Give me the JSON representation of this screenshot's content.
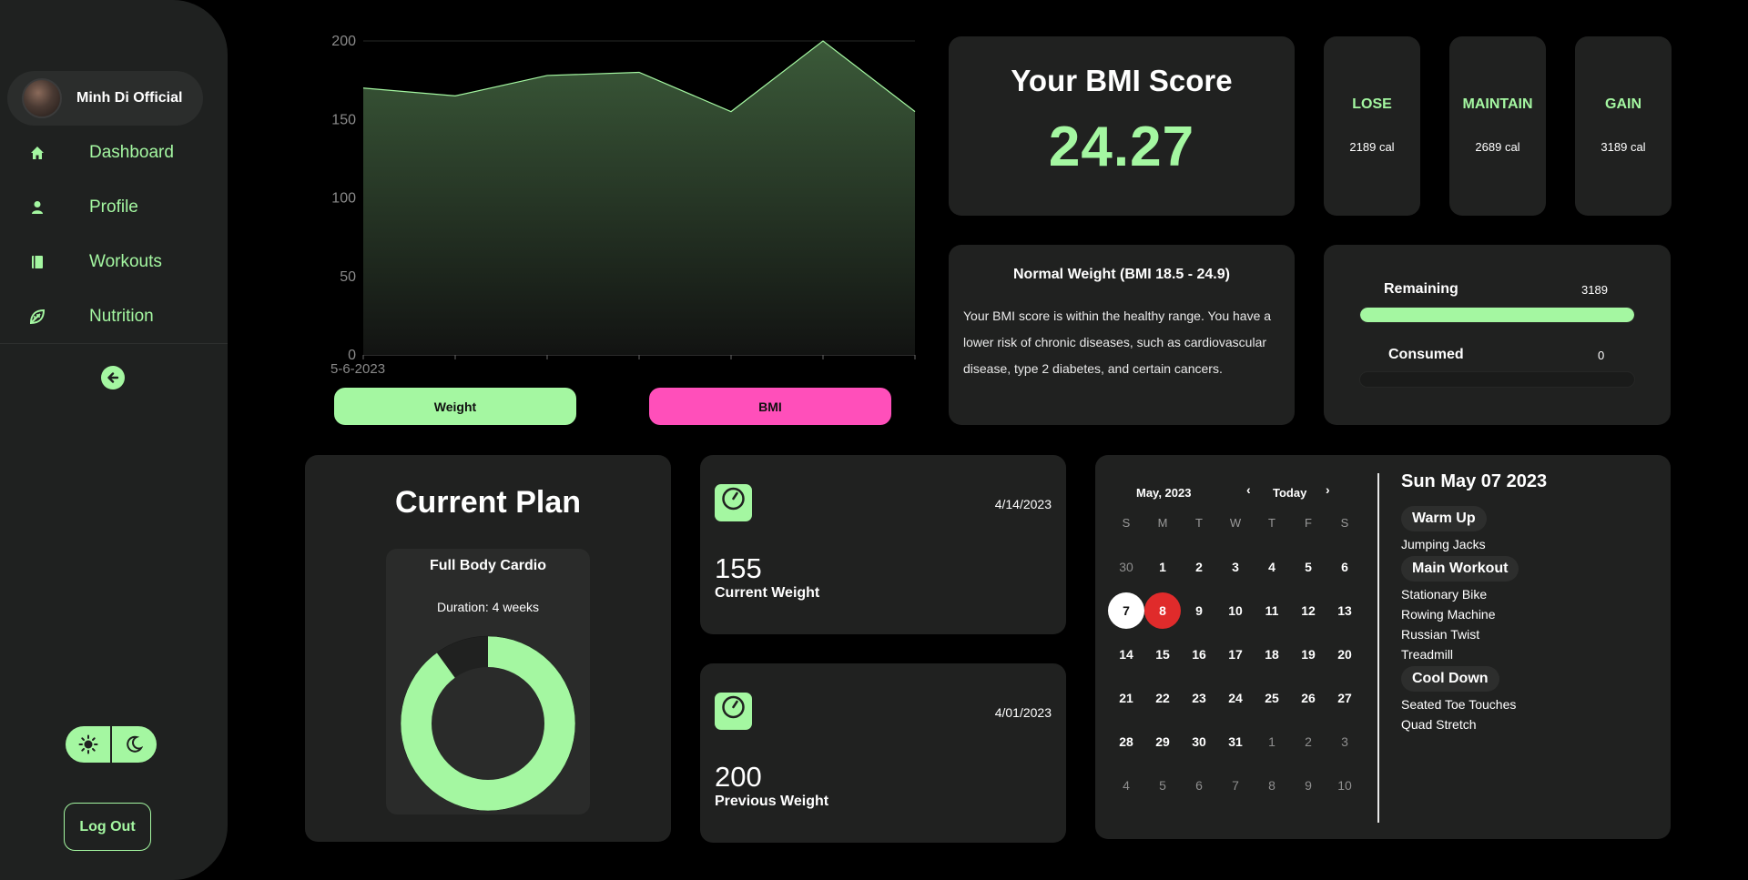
{
  "sidebar": {
    "profile_name": "Minh Di Official",
    "nav": [
      {
        "label": "Dashboard",
        "icon": "home-icon"
      },
      {
        "label": "Profile",
        "icon": "person-icon"
      },
      {
        "label": "Workouts",
        "icon": "book-icon"
      },
      {
        "label": "Nutrition",
        "icon": "leaf-icon"
      }
    ],
    "logout_label": "Log Out"
  },
  "chart_data": {
    "type": "area",
    "x": [
      "5-6-2023",
      "",
      "",
      "",
      "",
      "",
      ""
    ],
    "y": [
      170,
      165,
      178,
      180,
      155,
      200,
      155
    ],
    "ylim": [
      0,
      200
    ],
    "yticks": [
      0,
      50,
      100,
      150,
      200
    ],
    "xlabel": "",
    "ylabel": "",
    "first_x_label": "5-6-2023",
    "grid": true
  },
  "chart_buttons": {
    "weight": "Weight",
    "bmi": "BMI"
  },
  "bmi": {
    "title": "Your BMI Score",
    "value": "24.27"
  },
  "calories": [
    {
      "label": "LOSE",
      "value": "2189 cal"
    },
    {
      "label": "MAINTAIN",
      "value": "2689 cal"
    },
    {
      "label": "GAIN",
      "value": "3189 cal"
    }
  ],
  "info": {
    "title": "Normal Weight (BMI 18.5 - 24.9)",
    "text": "Your BMI score is within the healthy range. You have a lower risk of chronic diseases, such as cardiovascular disease, type 2 diabetes, and certain cancers."
  },
  "remaining": {
    "label": "Remaining",
    "value": "3189",
    "fraction": 1.0
  },
  "consumed": {
    "label": "Consumed",
    "value": "0",
    "fraction": 0.0
  },
  "plan": {
    "title": "Current Plan",
    "name": "Full Body Cardio",
    "duration": "Duration: 4 weeks",
    "progress_fraction": 0.9
  },
  "current_weight": {
    "date": "4/14/2023",
    "value": "155",
    "label": "Current Weight"
  },
  "previous_weight": {
    "date": "4/01/2023",
    "value": "200",
    "label": "Previous Weight"
  },
  "calendar": {
    "month": "May, 2023",
    "today_label": "Today",
    "prev": "‹",
    "next": "›",
    "dow": [
      "S",
      "M",
      "T",
      "W",
      "T",
      "F",
      "S"
    ],
    "weeks": [
      [
        "30",
        "1",
        "2",
        "3",
        "4",
        "5",
        "6"
      ],
      [
        "7",
        "8",
        "9",
        "10",
        "11",
        "12",
        "13"
      ],
      [
        "14",
        "15",
        "16",
        "17",
        "18",
        "19",
        "20"
      ],
      [
        "21",
        "22",
        "23",
        "24",
        "25",
        "26",
        "27"
      ],
      [
        "28",
        "29",
        "30",
        "31",
        "1",
        "2",
        "3"
      ],
      [
        "4",
        "5",
        "6",
        "7",
        "8",
        "9",
        "10"
      ]
    ],
    "today_day": "7",
    "selected_day": "8"
  },
  "schedule": {
    "date": "Sun May 07 2023",
    "warmup_title": "Warm Up",
    "warmup_items": [
      "Jumping Jacks"
    ],
    "main_title": "Main Workout",
    "main_items": [
      "Stationary Bike",
      "Rowing Machine",
      "Russian Twist",
      "Treadmill"
    ],
    "cooldown_title": "Cool Down",
    "cooldown_items": [
      "Seated Toe Touches",
      "Quad Stretch"
    ]
  },
  "colors": {
    "accent": "#a4f7a1",
    "pink": "#ff4fba",
    "card": "#202120",
    "today": "#ffffff",
    "selected": "#e02b2b"
  }
}
